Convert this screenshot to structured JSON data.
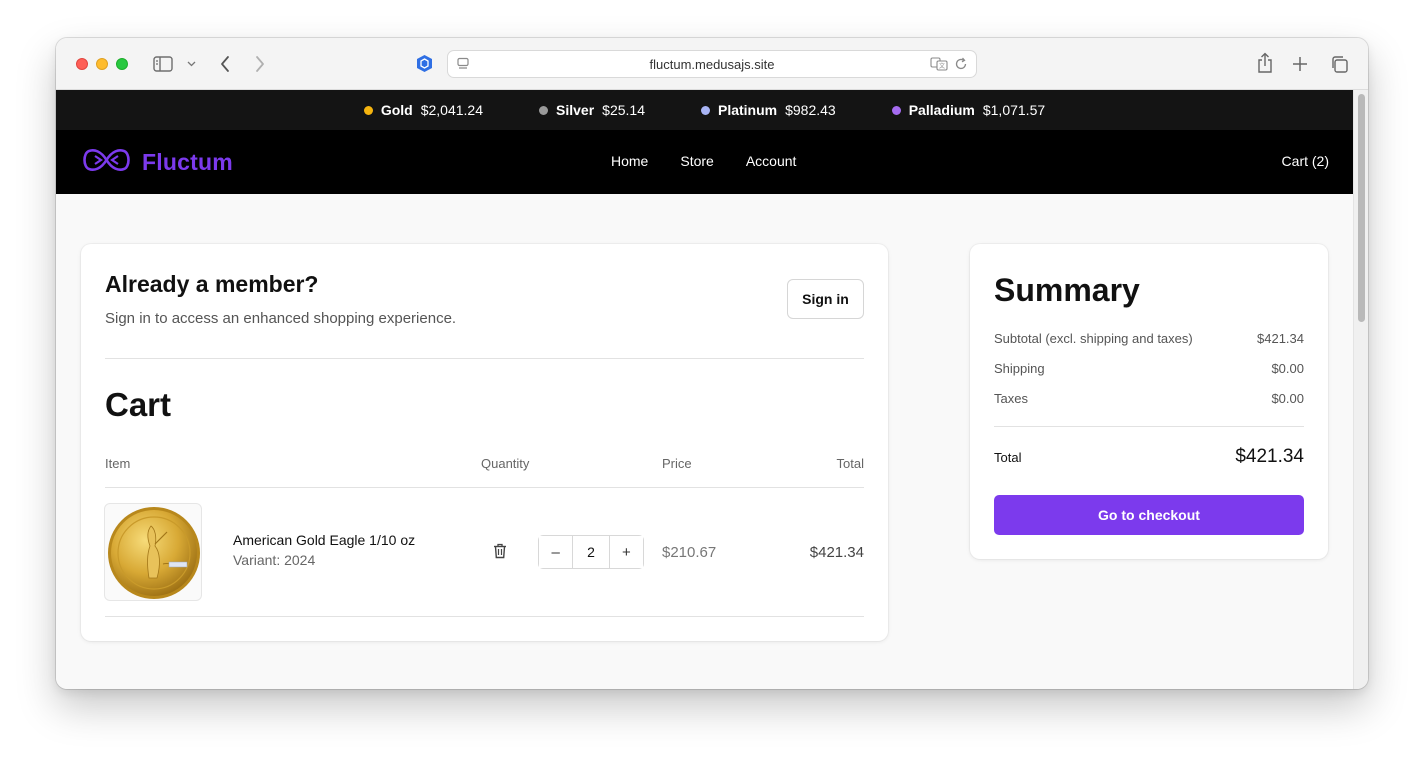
{
  "browser": {
    "url": "fluctum.medusajs.site"
  },
  "ticker": [
    {
      "name": "Gold",
      "price": "$2,041.24",
      "color": "#f5b40f"
    },
    {
      "name": "Silver",
      "price": "$25.14",
      "color": "#9a9a9a"
    },
    {
      "name": "Platinum",
      "price": "$982.43",
      "color": "#a8b4f5"
    },
    {
      "name": "Palladium",
      "price": "$1,071.57",
      "color": "#a56cf0"
    }
  ],
  "nav": {
    "brand": "Fluctum",
    "links": [
      "Home",
      "Store",
      "Account"
    ],
    "cart": "Cart (2)"
  },
  "member": {
    "title": "Already a member?",
    "subtitle": "Sign in to access an enhanced shopping experience.",
    "sign_in": "Sign in"
  },
  "cart": {
    "title": "Cart",
    "headers": {
      "item": "Item",
      "quantity": "Quantity",
      "price": "Price",
      "total": "Total"
    },
    "items": [
      {
        "name": "American Gold Eagle 1/10 oz",
        "variant": "Variant: 2024",
        "quantity": "2",
        "price": "$210.67",
        "total": "$421.34",
        "decrement": "–",
        "increment": "+"
      }
    ]
  },
  "summary": {
    "title": "Summary",
    "subtotal_label": "Subtotal (excl. shipping and taxes)",
    "subtotal_value": "$421.34",
    "shipping_label": "Shipping",
    "shipping_value": "$0.00",
    "taxes_label": "Taxes",
    "taxes_value": "$0.00",
    "total_label": "Total",
    "total_value": "$421.34",
    "checkout": "Go to checkout"
  },
  "colors": {
    "accent": "#7c3aed",
    "ticker_bg": "#141414",
    "nav_bg": "#000000"
  }
}
